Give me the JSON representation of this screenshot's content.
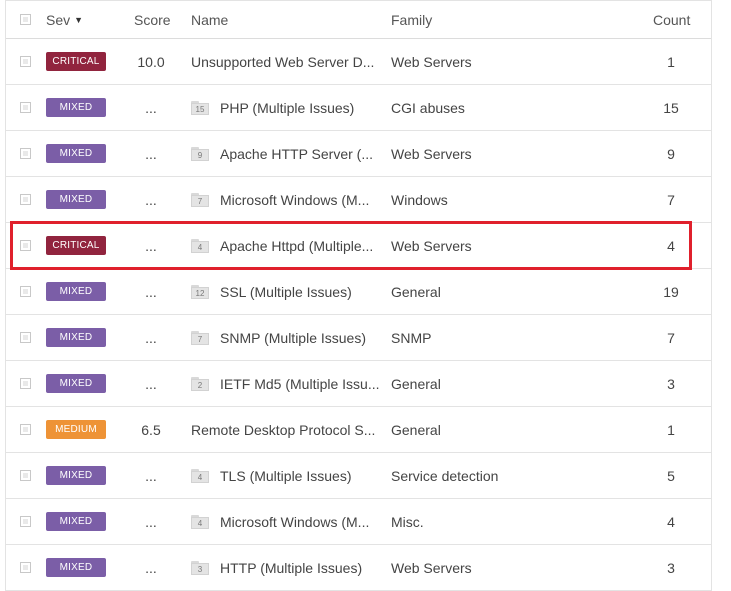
{
  "columns": {
    "sev": "Sev",
    "sort_indicator": "▼",
    "score": "Score",
    "name": "Name",
    "family": "Family",
    "count": "Count"
  },
  "severity_colors": {
    "CRITICAL": "#91243e",
    "MIXED": "#7b5ea7",
    "MEDIUM": "#ee9336"
  },
  "highlight_color": "#e0202c",
  "highlighted_row_index": 4,
  "rows": [
    {
      "sev": "CRITICAL",
      "score": "10.0",
      "group_count": "",
      "name": "Unsupported Web Server D...",
      "family": "Web Servers",
      "count": "1"
    },
    {
      "sev": "MIXED",
      "score": "...",
      "group_count": "15",
      "name": "PHP (Multiple Issues)",
      "family": "CGI abuses",
      "count": "15"
    },
    {
      "sev": "MIXED",
      "score": "...",
      "group_count": "9",
      "name": "Apache HTTP Server (...",
      "family": "Web Servers",
      "count": "9"
    },
    {
      "sev": "MIXED",
      "score": "...",
      "group_count": "7",
      "name": "Microsoft Windows (M...",
      "family": "Windows",
      "count": "7"
    },
    {
      "sev": "CRITICAL",
      "score": "...",
      "group_count": "4",
      "name": "Apache Httpd (Multiple...",
      "family": "Web Servers",
      "count": "4"
    },
    {
      "sev": "MIXED",
      "score": "...",
      "group_count": "12",
      "name": "SSL (Multiple Issues)",
      "family": "General",
      "count": "19"
    },
    {
      "sev": "MIXED",
      "score": "...",
      "group_count": "7",
      "name": "SNMP (Multiple Issues)",
      "family": "SNMP",
      "count": "7"
    },
    {
      "sev": "MIXED",
      "score": "...",
      "group_count": "2",
      "name": "IETF Md5 (Multiple Issu...",
      "family": "General",
      "count": "3"
    },
    {
      "sev": "MEDIUM",
      "score": "6.5",
      "group_count": "",
      "name": "Remote Desktop Protocol S...",
      "family": "General",
      "count": "1"
    },
    {
      "sev": "MIXED",
      "score": "...",
      "group_count": "4",
      "name": "TLS (Multiple Issues)",
      "family": "Service detection",
      "count": "5"
    },
    {
      "sev": "MIXED",
      "score": "...",
      "group_count": "4",
      "name": "Microsoft Windows (M...",
      "family": "Misc.",
      "count": "4"
    },
    {
      "sev": "MIXED",
      "score": "...",
      "group_count": "3",
      "name": "HTTP (Multiple Issues)",
      "family": "Web Servers",
      "count": "3"
    }
  ]
}
